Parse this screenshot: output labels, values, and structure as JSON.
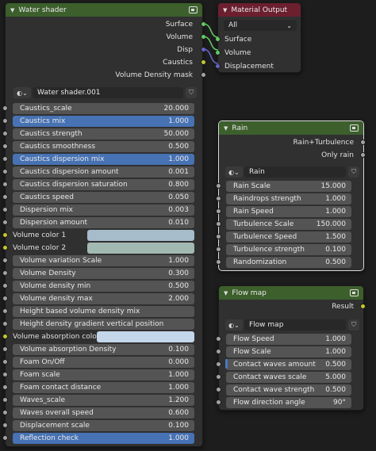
{
  "water_shader": {
    "title": "Water shader",
    "outputs": [
      "Surface",
      "Volume",
      "Disp",
      "Caustics",
      "Volume Density mask"
    ],
    "datablock": "Water shader.001",
    "inputs": [
      {
        "label": "Caustics_scale",
        "value": "20.000",
        "active": false
      },
      {
        "label": "Caustics mix",
        "value": "1.000",
        "active": true
      },
      {
        "label": "Caustics strength",
        "value": "50.000",
        "active": false
      },
      {
        "label": "Caustics smoothness",
        "value": "0.500",
        "active": false
      },
      {
        "label": "Caustics dispersion mix",
        "value": "1.000",
        "active": true
      },
      {
        "label": "Caustics dispersion amount",
        "value": "0.001",
        "active": false
      },
      {
        "label": "Caustics dispersion saturation",
        "value": "0.800",
        "active": false
      },
      {
        "label": "Caustics speed",
        "value": "0.050",
        "active": false
      },
      {
        "label": "Dispersion mix",
        "value": "0.003",
        "active": false
      },
      {
        "label": "Dispersion amount",
        "value": "0.010",
        "active": false
      }
    ],
    "color_inputs_a": [
      {
        "label": "Volume color 1",
        "color": "#a7bccb"
      },
      {
        "label": "Volume color 2",
        "color": "#a2b9b2"
      }
    ],
    "inputs_b": [
      {
        "label": "Volume variation Scale",
        "value": "1.000",
        "active": false
      },
      {
        "label": "Volume Density",
        "value": "0.300",
        "active": false
      },
      {
        "label": "Volume density min",
        "value": "0.500",
        "active": false
      },
      {
        "label": "Volume density max",
        "value": "2.000",
        "active": false
      },
      {
        "label": "Height based volume density mix",
        "value": "",
        "active": false
      },
      {
        "label": "Height density gradient vertical position",
        "value": "",
        "active": false
      }
    ],
    "color_input_b": {
      "label": "Volume absorption color",
      "color": "#c4d6ea"
    },
    "inputs_c": [
      {
        "label": "Volume absorption Density",
        "value": "0.100",
        "active": false
      },
      {
        "label": "Foam On/Off",
        "value": "0.000",
        "active": false
      },
      {
        "label": "Foam scale",
        "value": "1.000",
        "active": false
      },
      {
        "label": "Foam contact distance",
        "value": "1.000",
        "active": false
      },
      {
        "label": "Waves_scale",
        "value": "1.200",
        "active": false
      },
      {
        "label": "Waves overall speed",
        "value": "0.600",
        "active": false
      },
      {
        "label": "Displacement scale",
        "value": "0.100",
        "active": false
      },
      {
        "label": "Reflection check",
        "value": "1.000",
        "active": true
      }
    ]
  },
  "material_output": {
    "title": "Material Output",
    "target": "All",
    "inputs": [
      "Surface",
      "Volume",
      "Displacement"
    ]
  },
  "rain": {
    "title": "Rain",
    "outputs": [
      "Rain+Turbulence",
      "Only rain"
    ],
    "datablock": "Rain",
    "inputs": [
      {
        "label": "Rain Scale",
        "value": "15.000"
      },
      {
        "label": "Raindrops strength",
        "value": "1.000"
      },
      {
        "label": "Rain Speed",
        "value": "1.000"
      },
      {
        "label": "Turbulence Scale",
        "value": "150.000"
      },
      {
        "label": "Turbulence Speed",
        "value": "1.500"
      },
      {
        "label": "Turbulence strength",
        "value": "0.100"
      },
      {
        "label": "Randomization",
        "value": "0.500"
      }
    ]
  },
  "flow_map": {
    "title": "Flow map",
    "outputs": [
      "Result"
    ],
    "datablock": "Flow map",
    "inputs": [
      {
        "label": "Flow Speed",
        "value": "1.000"
      },
      {
        "label": "Flow Scale",
        "value": "1.000"
      },
      {
        "label": "Contact waves amount",
        "value": "0.500"
      },
      {
        "label": "Contact waves scale",
        "value": "5.000"
      },
      {
        "label": "Contact wave strength",
        "value": "0.500"
      },
      {
        "label": "Flow direction angle",
        "value": "90°"
      }
    ]
  },
  "colors": {
    "group_header": "#3c5f2c",
    "output_header": "#6b1f2f",
    "active_field": "#4772b3",
    "link_green": "#63c763",
    "link_blue": "#6363c7"
  }
}
